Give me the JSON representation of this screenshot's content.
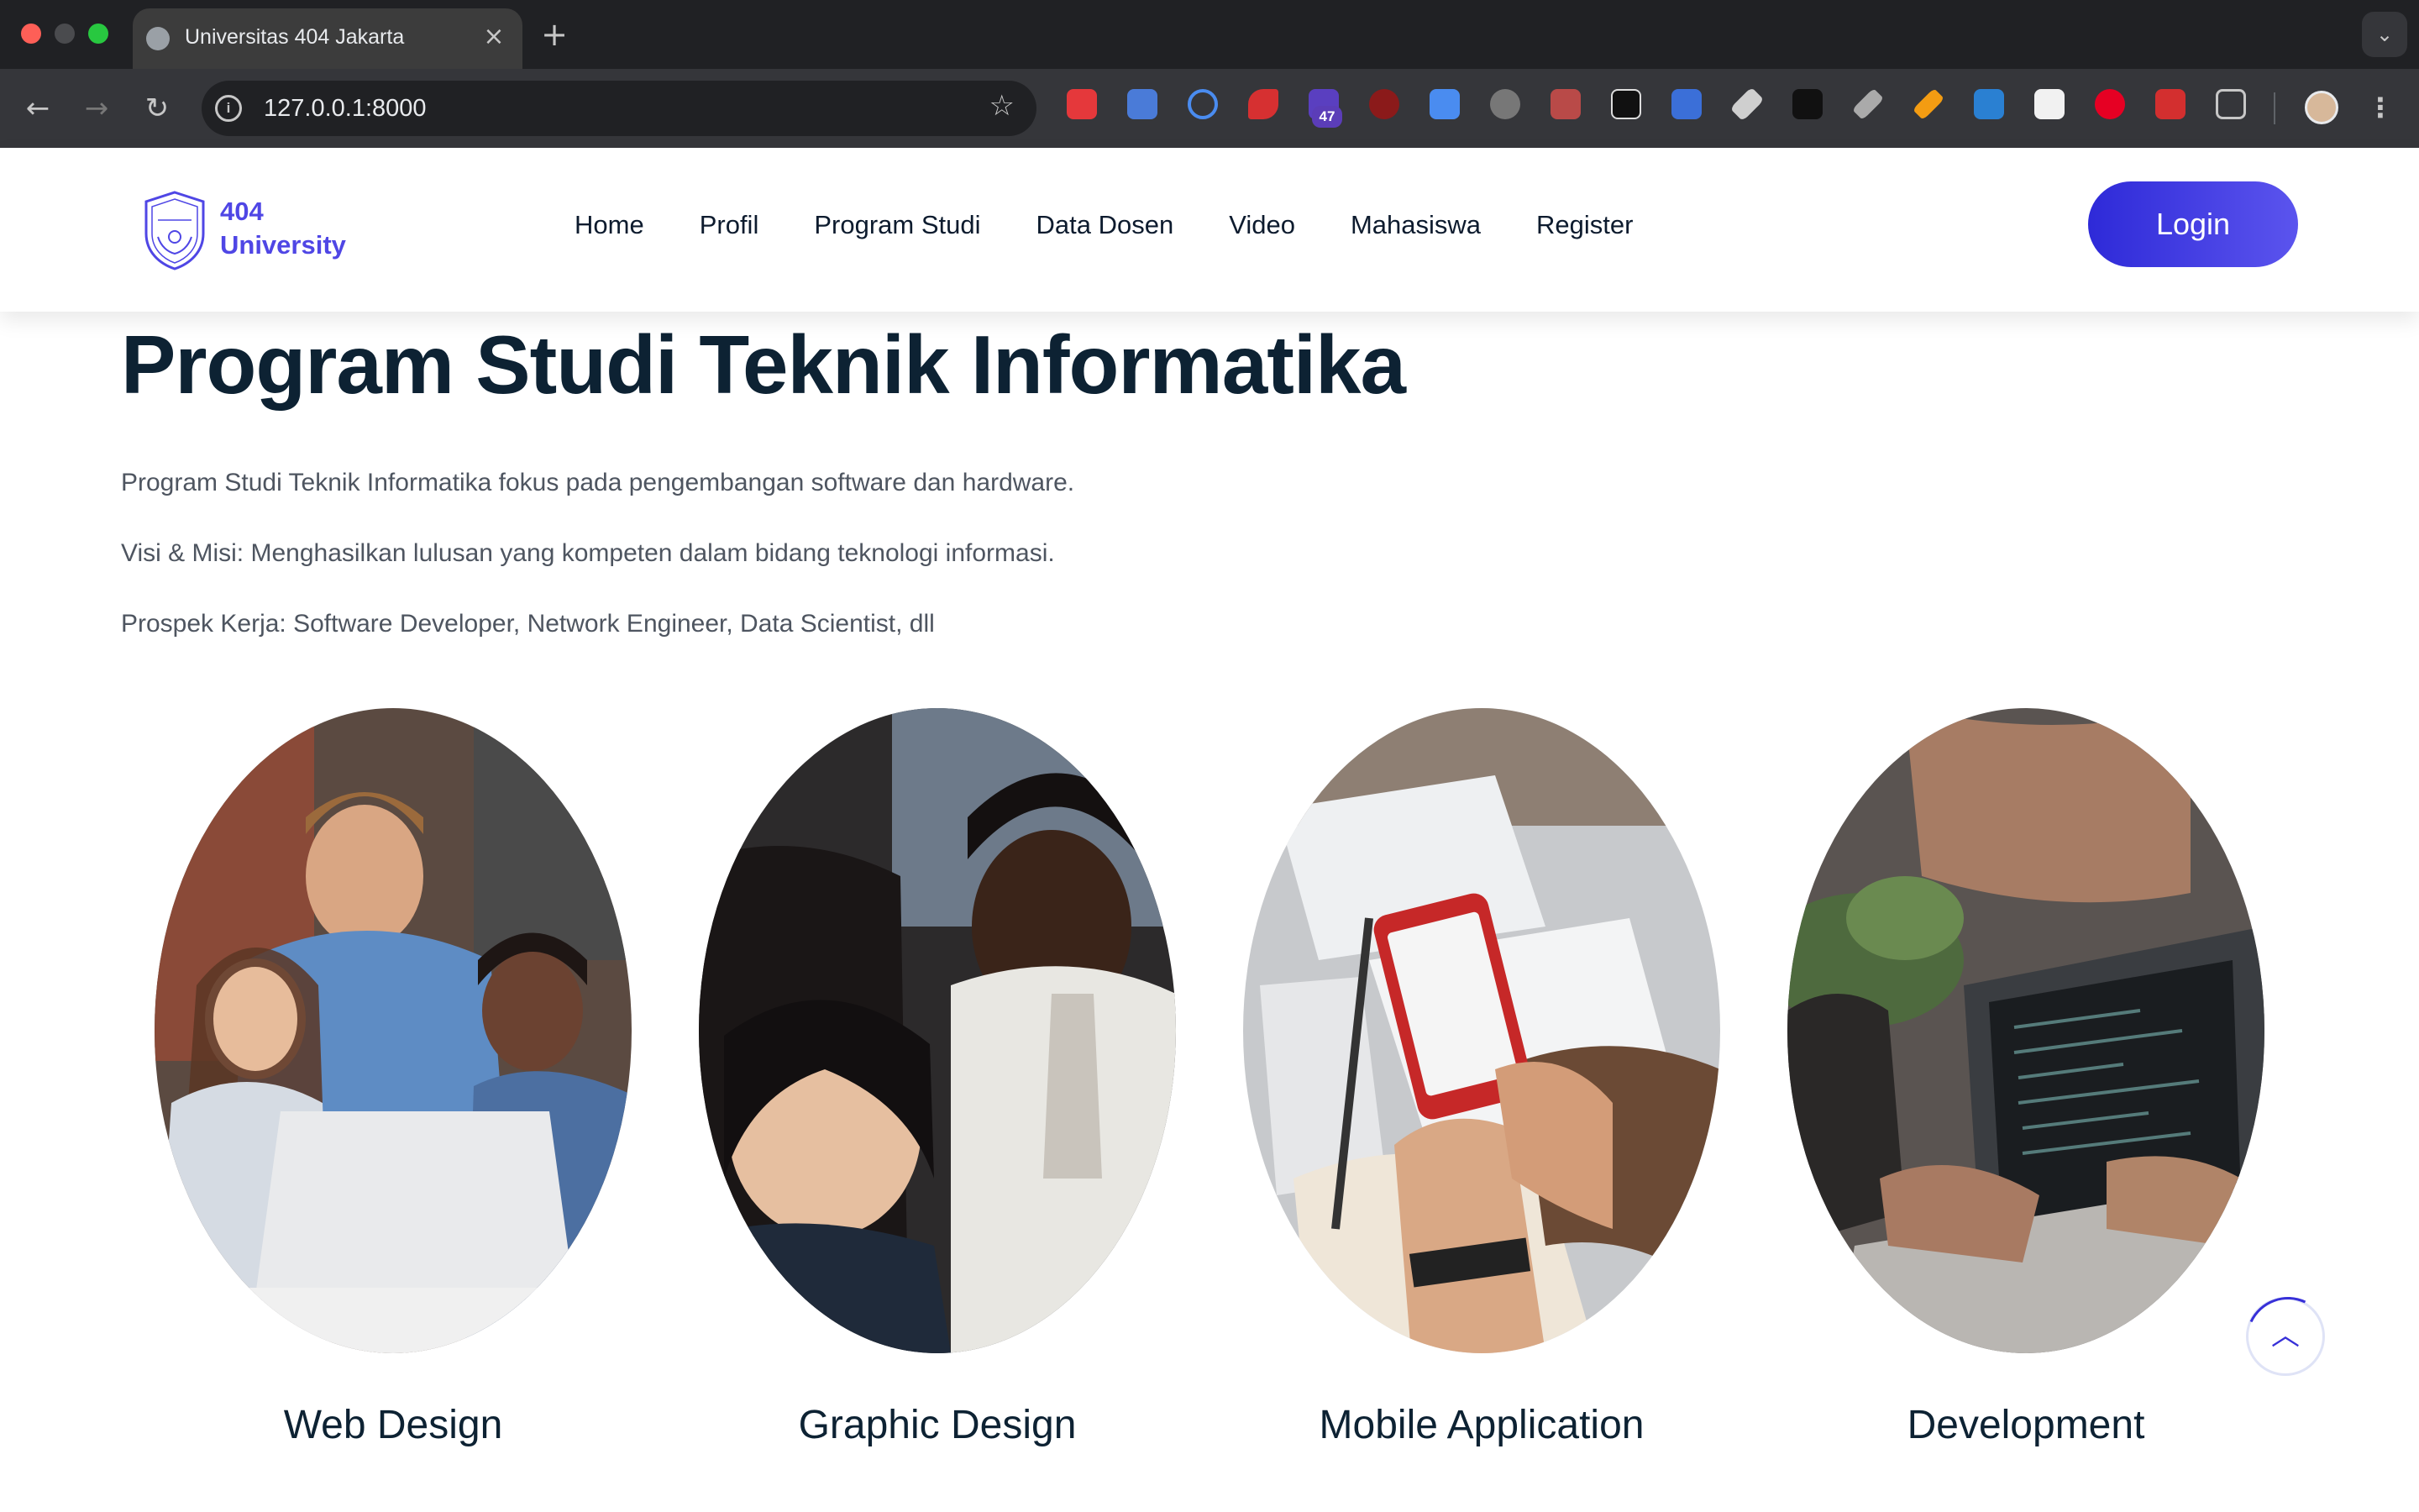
{
  "browser": {
    "tab_title": "Universitas 404 Jakarta",
    "url": "127.0.0.1:8000",
    "extension_badge": "47",
    "icons": [
      "globe-icon",
      "close-icon",
      "plus-icon",
      "chevron-down-icon",
      "back-arrow-icon",
      "forward-arrow-icon",
      "reload-icon",
      "info-icon",
      "star-icon",
      "puzzle-icon",
      "kebab-menu-icon"
    ]
  },
  "header": {
    "logo": {
      "line1": "404",
      "line2": "University",
      "color": "#4f46e5"
    },
    "nav": [
      "Home",
      "Profil",
      "Program Studi",
      "Data Dosen",
      "Video",
      "Mahasiswa",
      "Register"
    ],
    "login_label": "Login",
    "accent": "#3730d8"
  },
  "main": {
    "title": "Program Studi Teknik Informatika",
    "paragraphs": [
      "Program Studi Teknik Informatika fokus pada pengembangan software dan hardware.",
      "Visi & Misi: Menghasilkan lulusan yang kompeten dalam bidang teknologi informasi.",
      "Prospek Kerja: Software Developer, Network Engineer, Data Scientist, dll"
    ],
    "cards": [
      {
        "label": "Web Design"
      },
      {
        "label": "Graphic Design"
      },
      {
        "label": "Mobile Application"
      },
      {
        "label": "Development"
      }
    ]
  },
  "scroll_top_icon": "chevron-up-icon"
}
